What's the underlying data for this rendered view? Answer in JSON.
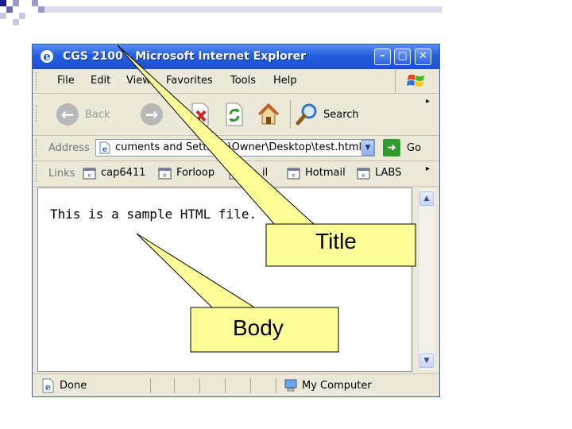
{
  "window": {
    "title": "CGS 2100 - Microsoft Internet Explorer",
    "controls": {
      "minimize": "–",
      "maximize": "▢",
      "close": "✕"
    }
  },
  "menubar": {
    "items": [
      "File",
      "Edit",
      "View",
      "Favorites",
      "Tools",
      "Help"
    ]
  },
  "toolbar": {
    "back_label": "Back",
    "search_label": "Search"
  },
  "address": {
    "label": "Address",
    "value": "cuments and Settings\\Owner\\Desktop\\test.html",
    "go_label": "Go"
  },
  "links": {
    "label": "Links",
    "items": [
      "cap6411",
      "Forloop",
      "il",
      "Hotmail",
      "LABS"
    ]
  },
  "content": {
    "text": "This is a sample HTML file."
  },
  "status": {
    "text": "Done",
    "zone": "My Computer"
  },
  "callouts": {
    "title": "Title",
    "body": "Body"
  },
  "colors": {
    "titlebar": "#245ee0",
    "callout_fill": "#ffff99",
    "accent_green": "#2e9c2e"
  }
}
